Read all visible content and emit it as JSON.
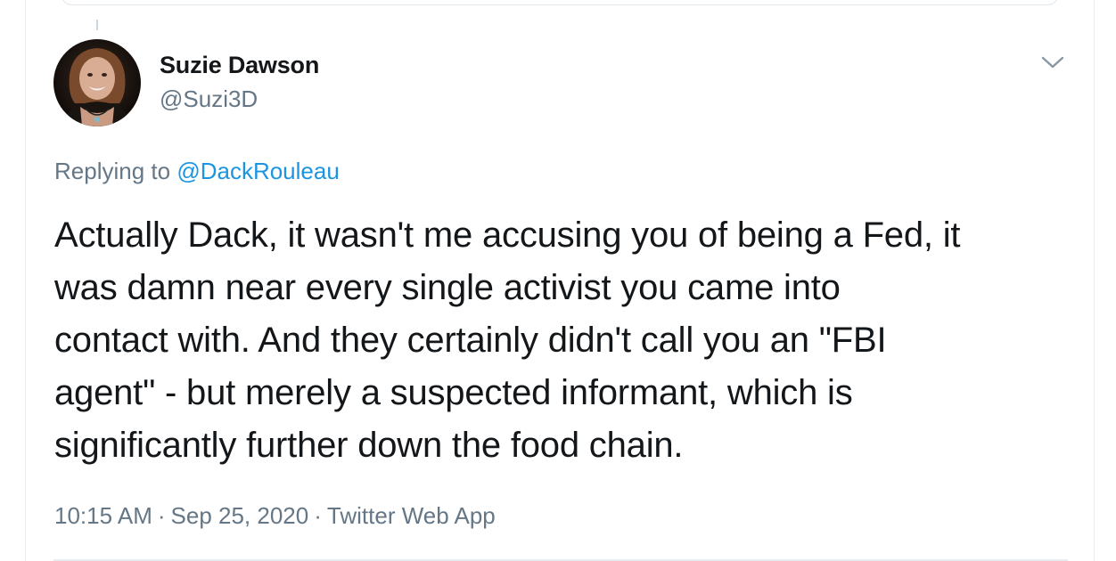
{
  "tweet": {
    "author": {
      "display_name": "Suzie Dawson",
      "handle": "@Suzi3D"
    },
    "replying": {
      "prefix": "Replying to",
      "mention": "@DackRouleau"
    },
    "text_lines": [
      "Actually Dack, it wasn't me accusing you of being a Fed, it",
      "was damn near every single activist you came into",
      "contact with. And they certainly didn't call you an \"FBI",
      "agent\" - but merely a suspected informant, which is",
      "significantly further down the food chain."
    ],
    "meta": {
      "time": "10:15 AM",
      "date": "Sep 25, 2020",
      "separator": "·",
      "source": "Twitter Web App"
    }
  },
  "icons": {
    "menu": "chevron-down-icon",
    "avatar": "avatar"
  },
  "colors": {
    "text_primary": "#14171a",
    "text_secondary": "#657786",
    "link": "#1b95e0",
    "border": "#e6ecf0"
  }
}
